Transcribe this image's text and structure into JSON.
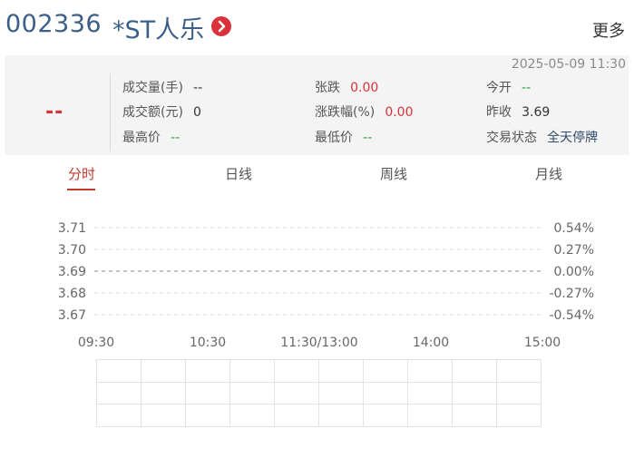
{
  "stock": {
    "code": "002336",
    "name": "*ST人乐",
    "more_label": "更多"
  },
  "quote": {
    "timestamp": "2025-05-09 11:30",
    "price": "--",
    "fields": [
      {
        "label": "成交量(手)",
        "value": "--",
        "color": "#333333"
      },
      {
        "label": "张跌",
        "value": "0.00",
        "color": "#d9323a"
      },
      {
        "label": "今开",
        "value": "--",
        "color": "#2e9c3e"
      },
      {
        "label": "成交额(元)",
        "value": "0",
        "color": "#333333"
      },
      {
        "label": "涨跌幅(%)",
        "value": "0.00",
        "color": "#d9323a"
      },
      {
        "label": "昨收",
        "value": "3.69",
        "color": "#333333"
      },
      {
        "label": "最高价",
        "value": "--",
        "color": "#2e9c3e"
      },
      {
        "label": "最低价",
        "value": "--",
        "color": "#2e9c3e"
      },
      {
        "label": "交易状态",
        "value": "全天停牌",
        "color": "#2f4a6b"
      }
    ]
  },
  "tabs": [
    {
      "label": "分时",
      "active": true
    },
    {
      "label": "日线",
      "active": false
    },
    {
      "label": "周线",
      "active": false
    },
    {
      "label": "月线",
      "active": false
    }
  ],
  "chart_data": {
    "type": "line",
    "price_ticks": [
      "3.71",
      "3.70",
      "3.69",
      "3.68",
      "3.67"
    ],
    "pct_ticks": [
      "0.54%",
      "0.27%",
      "0.00%",
      "-0.27%",
      "-0.54%"
    ],
    "x_ticks": [
      "09:30",
      "10:30",
      "11:30/13:00",
      "14:00",
      "15:00"
    ],
    "ylim": [
      3.67,
      3.71
    ],
    "baseline": 3.69,
    "series": [],
    "grid": true,
    "volume_grid": {
      "rows": 3,
      "cols": 10
    }
  },
  "colors": {
    "up": "#d9323a",
    "flat": "#2e9c3e",
    "brand": "#3b5f86"
  }
}
